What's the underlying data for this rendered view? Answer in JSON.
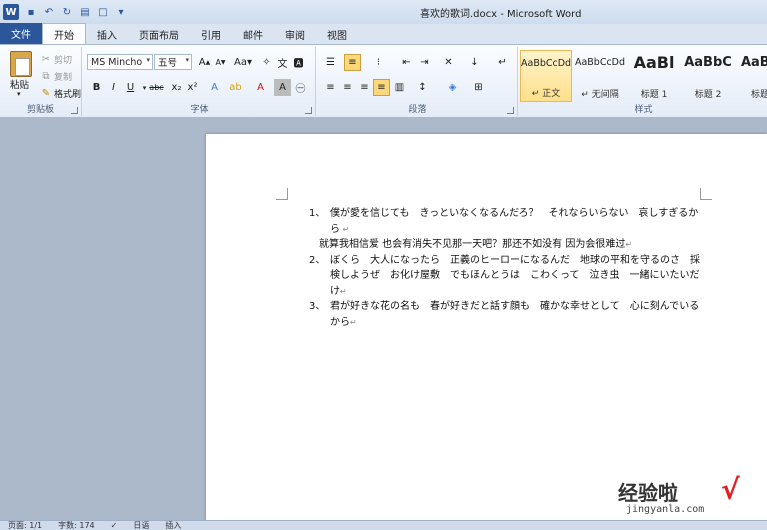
{
  "window": {
    "title": "喜欢的歌词.docx - Microsoft Word"
  },
  "tabs": [
    {
      "label": "文件"
    },
    {
      "label": "开始"
    },
    {
      "label": "插入"
    },
    {
      "label": "页面布局"
    },
    {
      "label": "引用"
    },
    {
      "label": "邮件"
    },
    {
      "label": "审阅"
    },
    {
      "label": "视图"
    }
  ],
  "clipboard": {
    "paste": "粘贴",
    "cut": "剪切",
    "copy": "复制",
    "format_painter": "格式刷",
    "group": "剪贴板"
  },
  "font": {
    "name": "MS Mincho",
    "size": "五号",
    "group": "字体"
  },
  "paragraph": {
    "group": "段落"
  },
  "styles": {
    "group": "样式",
    "items": [
      {
        "sample": "AaBbCcDd",
        "name": "↵ 正文"
      },
      {
        "sample": "AaBbCcDd",
        "name": "↵ 无间隔"
      },
      {
        "sample": "AaBl",
        "name": "标题 1"
      },
      {
        "sample": "AaBbC",
        "name": "标题 2"
      },
      {
        "sample": "AaBb",
        "name": "标题"
      }
    ]
  },
  "document": {
    "paragraphs": [
      {
        "num": "1、",
        "text": "僕が愛を信じても　きっといなくなるんだろ？　それならいらない　哀しすぎるから"
      },
      {
        "num": "",
        "text": "就算我相信爱 也会有消失不见那一天吧？那还不如没有 因为会很难过"
      },
      {
        "num": "2、",
        "text": "ぼくら　大人になったら　正義のヒーローになるんだ　地球の平和を守るのさ　採検しようぜ　お化け屋敷　でもほんとうは　こわくって　泣き虫　一緒にいたいだけ"
      },
      {
        "num": "3、",
        "text": "君が好きな花の名も　春が好きだと話す顔も　確かな幸せとして　心に刻んでいるから"
      }
    ]
  },
  "statusbar": {
    "page": "页面: 1/1",
    "words": "字数: 174",
    "language": "日语",
    "mode": "插入"
  },
  "watermark": {
    "main": "经验啦",
    "url": "jingyanla.com"
  }
}
